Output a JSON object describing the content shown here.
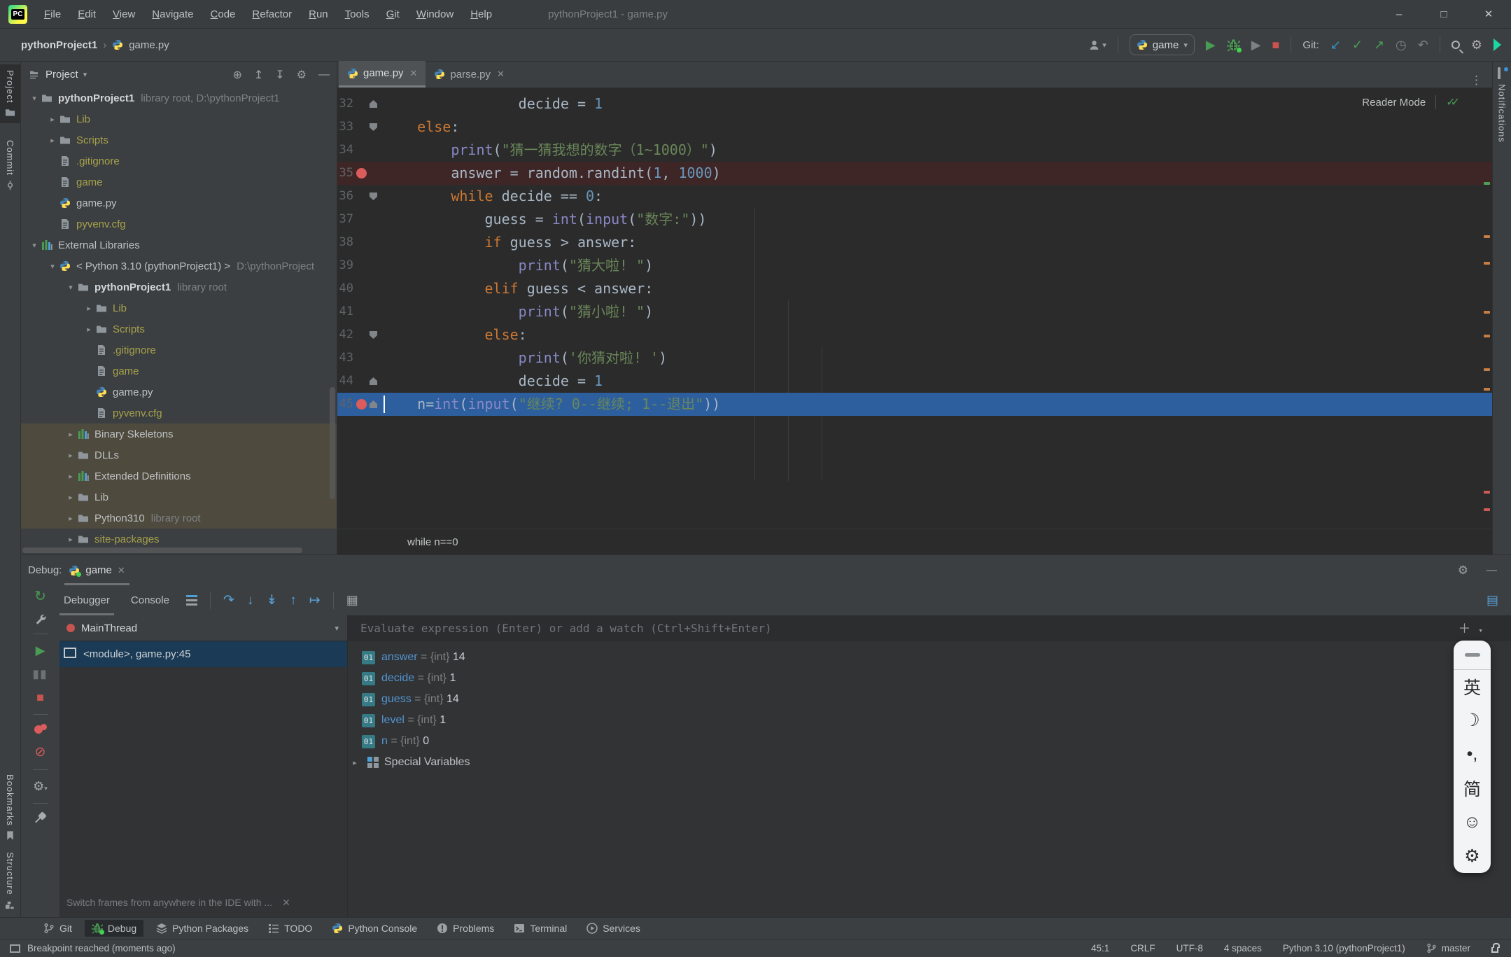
{
  "window": {
    "title": "pythonProject1 - game.py",
    "menus": [
      "File",
      "Edit",
      "View",
      "Navigate",
      "Code",
      "Refactor",
      "Run",
      "Tools",
      "Git",
      "Window",
      "Help"
    ]
  },
  "toolbar": {
    "breadcrumb_project": "pythonProject1",
    "breadcrumb_file": "game.py",
    "run_config": "game",
    "git_label": "Git:"
  },
  "left_strip": {
    "project": "Project",
    "commit": "Commit",
    "bookmarks": "Bookmarks",
    "structure": "Structure"
  },
  "right_strip": {
    "notifications": "Notifications"
  },
  "project_panel": {
    "title": "Project",
    "tree": [
      {
        "level": 0,
        "arrow": "down",
        "icon": "folder",
        "label": "pythonProject1",
        "style": "bold",
        "suffix": "library root,  D:\\pythonProject1"
      },
      {
        "level": 1,
        "arrow": "right",
        "icon": "folder",
        "label": "Lib",
        "style": "olive"
      },
      {
        "level": 1,
        "arrow": "right",
        "icon": "folder",
        "label": "Scripts",
        "style": "olive"
      },
      {
        "level": 1,
        "arrow": "none",
        "icon": "file",
        "label": ".gitignore",
        "style": "olive"
      },
      {
        "level": 1,
        "arrow": "none",
        "icon": "file",
        "label": "game",
        "style": "olive"
      },
      {
        "level": 1,
        "arrow": "none",
        "icon": "py",
        "label": "game.py",
        "style": "norm"
      },
      {
        "level": 1,
        "arrow": "none",
        "icon": "file",
        "label": "pyvenv.cfg",
        "style": "olive"
      },
      {
        "level": 0,
        "arrow": "down",
        "icon": "libs",
        "label": "External Libraries",
        "style": "norm"
      },
      {
        "level": 1,
        "arrow": "down",
        "icon": "py",
        "label": "< Python 3.10 (pythonProject1) >",
        "style": "norm",
        "suffix": "D:\\pythonProject"
      },
      {
        "level": 2,
        "arrow": "down",
        "icon": "folder",
        "label": "pythonProject1",
        "style": "bold",
        "suffix": "library root"
      },
      {
        "level": 3,
        "arrow": "right",
        "icon": "folder",
        "label": "Lib",
        "style": "olive"
      },
      {
        "level": 3,
        "arrow": "right",
        "icon": "folder",
        "label": "Scripts",
        "style": "olive"
      },
      {
        "level": 3,
        "arrow": "none",
        "icon": "file",
        "label": ".gitignore",
        "style": "olive"
      },
      {
        "level": 3,
        "arrow": "none",
        "icon": "file",
        "label": "game",
        "style": "olive"
      },
      {
        "level": 3,
        "arrow": "none",
        "icon": "py",
        "label": "game.py",
        "style": "norm"
      },
      {
        "level": 3,
        "arrow": "none",
        "icon": "file",
        "label": "pyvenv.cfg",
        "style": "olive"
      },
      {
        "level": 2,
        "arrow": "right",
        "icon": "libs",
        "label": "Binary Skeletons",
        "style": "norm",
        "highlight": true
      },
      {
        "level": 2,
        "arrow": "right",
        "icon": "folder",
        "label": "DLLs",
        "style": "norm",
        "highlight": true
      },
      {
        "level": 2,
        "arrow": "right",
        "icon": "libs",
        "label": "Extended Definitions",
        "style": "norm",
        "highlight": true
      },
      {
        "level": 2,
        "arrow": "right",
        "icon": "folder",
        "label": "Lib",
        "style": "norm",
        "highlight": true
      },
      {
        "level": 2,
        "arrow": "right",
        "icon": "folder",
        "label": "Python310",
        "style": "norm",
        "suffix": "library root",
        "highlight": true
      },
      {
        "level": 2,
        "arrow": "right",
        "icon": "folder",
        "label": "site-packages",
        "style": "olive"
      }
    ]
  },
  "editor": {
    "tabs": [
      {
        "label": "game.py"
      },
      {
        "label": "parse.py"
      }
    ],
    "reader_mode": "Reader Mode",
    "context_bar": "while n==0",
    "lines": [
      {
        "n": 32,
        "indent": 16,
        "fold": "up",
        "tokens": [
          [
            "decide = ",
            "p"
          ],
          [
            "1",
            "n"
          ]
        ]
      },
      {
        "n": 33,
        "indent": 4,
        "fold": "down",
        "tokens": [
          [
            "else",
            "k"
          ],
          [
            ":",
            "p"
          ]
        ]
      },
      {
        "n": 34,
        "indent": 8,
        "tokens": [
          [
            "print",
            "f"
          ],
          [
            "(",
            "p"
          ],
          [
            "\"猜一猜我想的数字（1~1000）\"",
            "s"
          ],
          [
            ")",
            "p"
          ]
        ]
      },
      {
        "n": 35,
        "indent": 8,
        "bp": true,
        "hl": "bp",
        "tokens": [
          [
            "answer = random.randint(",
            "p"
          ],
          [
            "1",
            "n"
          ],
          [
            ", ",
            "p"
          ],
          [
            "1000",
            "n"
          ],
          [
            ")",
            "p"
          ]
        ]
      },
      {
        "n": 36,
        "indent": 8,
        "fold": "down",
        "tokens": [
          [
            "while",
            "k"
          ],
          [
            " decide == ",
            "p"
          ],
          [
            "0",
            "n"
          ],
          [
            ":",
            "p"
          ]
        ]
      },
      {
        "n": 37,
        "indent": 12,
        "tokens": [
          [
            "guess = ",
            "p"
          ],
          [
            "int",
            "f"
          ],
          [
            "(",
            "p"
          ],
          [
            "input",
            "f"
          ],
          [
            "(",
            "p"
          ],
          [
            "\"数字:\"",
            "s"
          ],
          [
            "))",
            "p"
          ]
        ]
      },
      {
        "n": 38,
        "indent": 12,
        "tokens": [
          [
            "if",
            "k"
          ],
          [
            " guess > answer:",
            "p"
          ]
        ]
      },
      {
        "n": 39,
        "indent": 16,
        "tokens": [
          [
            "print",
            "f"
          ],
          [
            "(",
            "p"
          ],
          [
            "\"猜大啦! \"",
            "s"
          ],
          [
            ")",
            "p"
          ]
        ]
      },
      {
        "n": 40,
        "indent": 12,
        "tokens": [
          [
            "elif",
            "k"
          ],
          [
            " guess < answer:",
            "p"
          ]
        ]
      },
      {
        "n": 41,
        "indent": 16,
        "tokens": [
          [
            "print",
            "f"
          ],
          [
            "(",
            "p"
          ],
          [
            "\"猜小啦! \"",
            "s"
          ],
          [
            ")",
            "p"
          ]
        ]
      },
      {
        "n": 42,
        "indent": 12,
        "fold": "down",
        "tokens": [
          [
            "else",
            "k"
          ],
          [
            ":",
            "p"
          ]
        ]
      },
      {
        "n": 43,
        "indent": 16,
        "tokens": [
          [
            "print",
            "f"
          ],
          [
            "(",
            "p"
          ],
          [
            "'你猜对啦! '",
            "s"
          ],
          [
            ")",
            "p"
          ]
        ]
      },
      {
        "n": 44,
        "indent": 16,
        "fold": "up",
        "tokens": [
          [
            "decide = ",
            "p"
          ],
          [
            "1",
            "n"
          ]
        ]
      },
      {
        "n": 45,
        "indent": 4,
        "bp": true,
        "fold": "up",
        "hl": "exec",
        "tokens": [
          [
            "n=",
            "p"
          ],
          [
            "int",
            "f"
          ],
          [
            "(",
            "p"
          ],
          [
            "input",
            "f"
          ],
          [
            "(",
            "p"
          ],
          [
            "\"继续? 0--继续; 1--退出\"",
            "s"
          ],
          [
            "))",
            "p"
          ]
        ]
      }
    ]
  },
  "debug": {
    "label": "Debug:",
    "session": "game",
    "tabs": [
      "Debugger",
      "Console"
    ],
    "thread": "MainThread",
    "frame": "<module>, game.py:45",
    "evaluate_placeholder": "Evaluate expression (Enter) or add a watch (Ctrl+Shift+Enter)",
    "variables": [
      {
        "name": "answer",
        "type": "{int}",
        "value": "14"
      },
      {
        "name": "decide",
        "type": "{int}",
        "value": "1"
      },
      {
        "name": "guess",
        "type": "{int}",
        "value": "14"
      },
      {
        "name": "level",
        "type": "{int}",
        "value": "1"
      },
      {
        "name": "n",
        "type": "{int}",
        "value": "0"
      }
    ],
    "special_variables": "Special Variables",
    "hint": "Switch frames from anywhere in the IDE with ..."
  },
  "ime": {
    "items": [
      {
        "name": "english-mode",
        "glyph": "英"
      },
      {
        "name": "halfwidth-mode",
        "glyph": "☽"
      },
      {
        "name": "punctuation-mode",
        "glyph": "•,"
      },
      {
        "name": "simplified-mode",
        "glyph": "简"
      },
      {
        "name": "emoji-picker",
        "glyph": "☺"
      },
      {
        "name": "ime-settings",
        "glyph": "⚙"
      }
    ]
  },
  "bottom_bar": {
    "items": [
      "Git",
      "Debug",
      "Python Packages",
      "TODO",
      "Python Console",
      "Problems",
      "Terminal",
      "Services"
    ],
    "active": "Debug"
  },
  "status_bar": {
    "message": "Breakpoint reached (moments ago)",
    "caret": "45:1",
    "line_ending": "CRLF",
    "encoding": "UTF-8",
    "indent": "4 spaces",
    "interpreter": "Python 3.10 (pythonProject1)",
    "branch": "master"
  },
  "colors": {
    "accent_exec_line": "#2d5f9e",
    "breakpoint_line": "#3e2626",
    "breakpoint_dot": "#db5c5c",
    "keyword": "#cc7832",
    "string": "#6a8759",
    "number": "#6897bb",
    "builtin": "#8888c6",
    "ignored_file": "#a6a14b",
    "run_green": "#499c54",
    "stop_red": "#c75450",
    "git_blue": "#3592c4"
  }
}
